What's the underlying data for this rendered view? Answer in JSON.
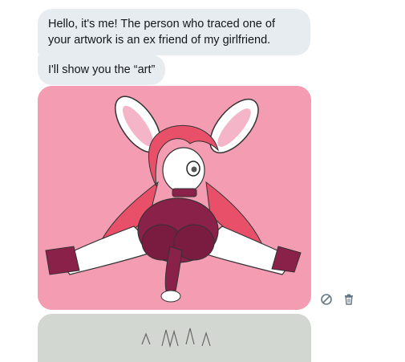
{
  "messages": [
    {
      "text": "Hello, it's me! The person who traced one of your artwork is an ex friend of my girlfriend."
    },
    {
      "text": "I'll show you the “art”"
    }
  ],
  "media": [
    {
      "kind": "image",
      "subject": "pink bunny-eared character drawing"
    },
    {
      "kind": "image",
      "subject": "pencil sketch on paper (partially visible)"
    }
  ],
  "actions": [
    {
      "icon": "no-entry-icon"
    },
    {
      "icon": "trash-icon"
    }
  ],
  "colors": {
    "bubble_bg": "#e6ecf0",
    "text": "#14171a",
    "icon": "#657786",
    "image_bg": "#f39cb2"
  }
}
